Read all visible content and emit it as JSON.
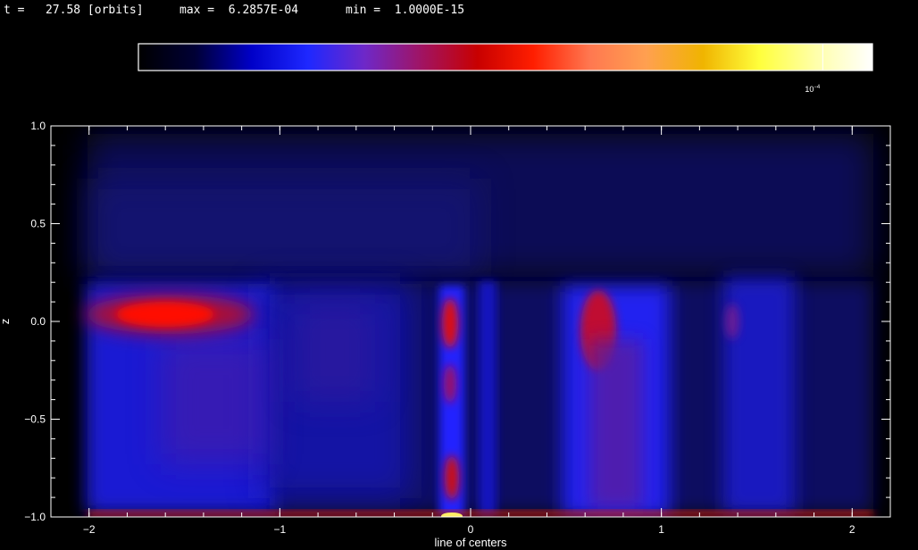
{
  "header": {
    "time_label": "t =   27.58 [orbits]",
    "max_label": "max =  6.2857E-04",
    "min_label": "min =  1.0000E-15"
  },
  "colorbar": {
    "tick_label": "10",
    "tick_exponent": "−4",
    "tick_value": 0.0001,
    "vmin": 1e-15,
    "vmax": 0.00062857,
    "scale": "log",
    "colormap_stops": [
      "#000000",
      "#000035",
      "#0000c8",
      "#1e28ff",
      "#6e28c8",
      "#a01464",
      "#c80000",
      "#ff1e00",
      "#ff7850",
      "#ffa050",
      "#f0b400",
      "#ffff3c",
      "#ffffaa",
      "#ffffff"
    ]
  },
  "chart_data": {
    "type": "heatmap",
    "title": "",
    "xlabel": "line of centers",
    "ylabel": "z",
    "xlim": [
      -2.2,
      2.2
    ],
    "ylim": [
      -1.0,
      1.0
    ],
    "x_ticks": [
      -2,
      -1,
      0,
      1,
      2
    ],
    "x_tick_labels": [
      "−2",
      "−1",
      "0",
      "1",
      "2"
    ],
    "y_ticks": [
      -1.0,
      -0.5,
      0.0,
      0.5,
      1.0
    ],
    "y_tick_labels": [
      "−1.0",
      "−0.5",
      "0.0",
      "0.5",
      "1.0"
    ],
    "x_minor_step": 0.2,
    "y_minor_step": 0.1,
    "data_extent_x": [
      -2.0,
      2.0
    ],
    "features": [
      {
        "region": "hot blob",
        "x": [
          -2.0,
          -1.0
        ],
        "z": [
          -0.05,
          0.1
        ],
        "peak_x": -1.63,
        "peak_z": 0.04,
        "level": "red"
      },
      {
        "region": "narrow column",
        "x": [
          -0.22,
          -0.12
        ],
        "z": [
          -1.0,
          0.25
        ],
        "level": "red"
      },
      {
        "region": "column",
        "x": [
          0.45,
          0.95
        ],
        "z": [
          -1.0,
          0.15
        ],
        "level": "red-purple"
      },
      {
        "region": "column",
        "x": [
          1.25,
          1.6
        ],
        "z": [
          -1.0,
          0.2
        ],
        "level": "blue"
      },
      {
        "region": "lower layer",
        "x": [
          -2.0,
          2.0
        ],
        "z": [
          -1.0,
          0.25
        ],
        "level": "blue"
      },
      {
        "region": "upper halo",
        "x": [
          -2.0,
          2.0
        ],
        "z": [
          0.25,
          1.0
        ],
        "level": "dark blue"
      }
    ]
  }
}
